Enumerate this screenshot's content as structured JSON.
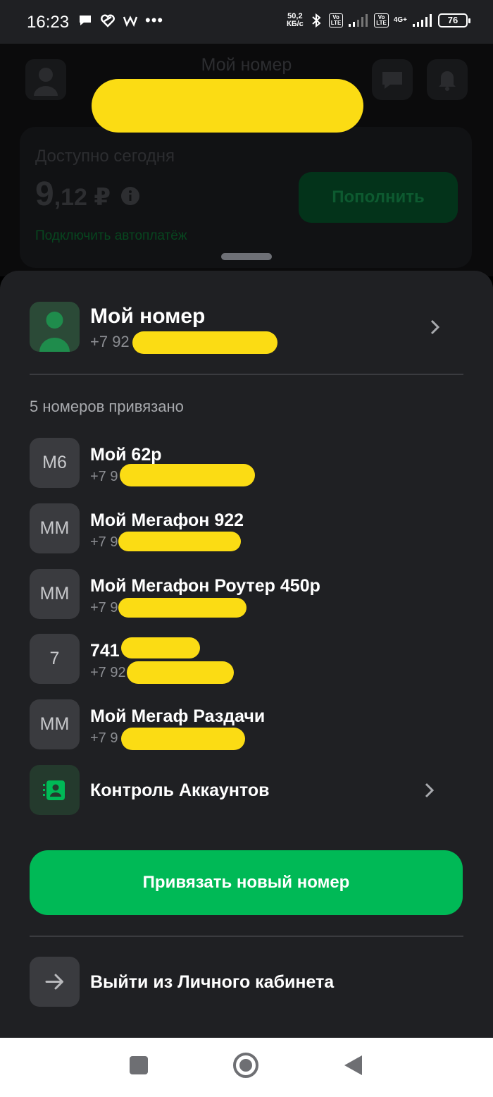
{
  "status_bar": {
    "time": "16:23",
    "speed_value": "50,2",
    "speed_unit": "КБ/с",
    "volte1_top": "Vo",
    "volte1_bottom": "LTE",
    "volte2_top": "Vo",
    "volte2_bottom": "LTE",
    "network": "4G+",
    "battery": "76",
    "icons": [
      "chat-bubble-icon",
      "heart-icon",
      "w-app-icon",
      "more-dots-icon",
      "bluetooth-icon",
      "signal-icon",
      "signal-icon",
      "battery-icon"
    ]
  },
  "background": {
    "title": "Мой номер",
    "available_label": "Доступно сегодня",
    "balance_int": "9",
    "balance_frac": ",12 ₽",
    "topup_label": "Пополнить",
    "autopay_label": "Подключить автоплатёж"
  },
  "sheet": {
    "main_account": {
      "title": "Мой номер",
      "phone": "+7 92"
    },
    "linked_count_label": "5 номеров привязано",
    "linked": [
      {
        "initials": "М6",
        "name": "Мой 62р",
        "phone": "+7 9"
      },
      {
        "initials": "ММ",
        "name": "Мой Мегафон 922",
        "phone": "+7 9"
      },
      {
        "initials": "ММ",
        "name": "Мой Мегафон Роутер 450р",
        "phone": "+7 9"
      },
      {
        "initials": "7",
        "name": "741",
        "phone": "+7 92"
      },
      {
        "initials": "ММ",
        "name": "Мой Мегаф Раздачи",
        "phone": "+7 9"
      }
    ],
    "accounts_control_label": "Контроль Аккаунтов",
    "link_new_label": "Привязать новый номер",
    "logout_label": "Выйти из Личного кабинета"
  },
  "colors": {
    "sheet_bg": "#1f2023",
    "accent_green": "#00b956",
    "tile_bg": "#3a3b3f",
    "redaction": "#fbdc14"
  }
}
